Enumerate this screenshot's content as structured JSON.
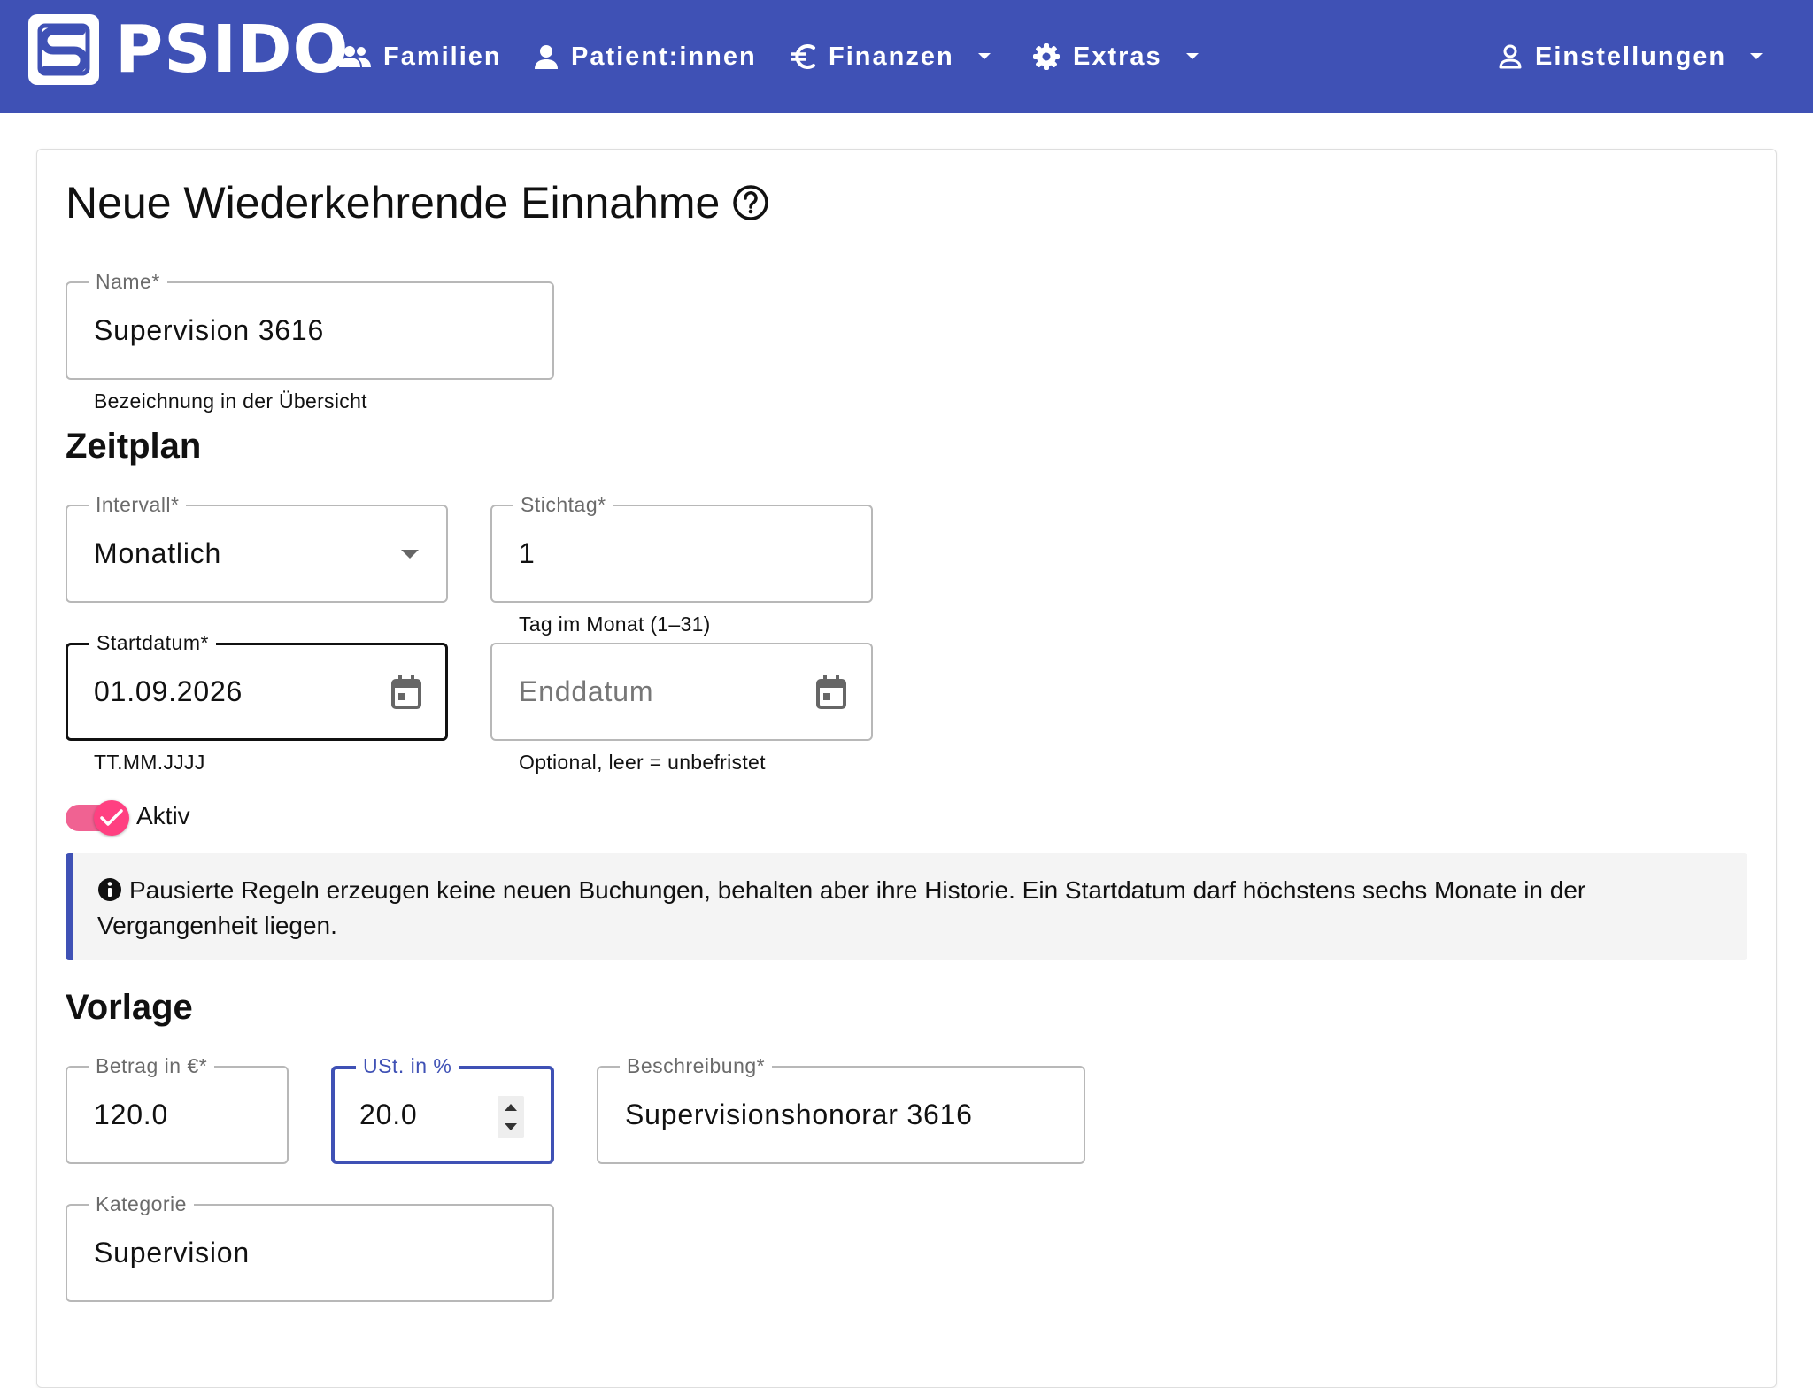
{
  "app": {
    "brand": "PSIDO",
    "colors": {
      "primary": "#3f51b5",
      "accent": "#ff4081",
      "accent_track": "#f06292"
    }
  },
  "nav": {
    "items": [
      {
        "label": "Familien",
        "icon": "group-icon"
      },
      {
        "label": "Patient:innen",
        "icon": "person-icon"
      },
      {
        "label": "Finanzen",
        "icon": "euro-icon",
        "dropdown": true
      },
      {
        "label": "Extras",
        "icon": "gear-icon",
        "dropdown": true
      }
    ],
    "settings": {
      "label": "Einstellungen",
      "icon": "person-outline-icon",
      "dropdown": true
    }
  },
  "page": {
    "title": "Neue Wiederkehrende Einnahme"
  },
  "form": {
    "name": {
      "label": "Name*",
      "value": "Supervision 3616",
      "helper": "Bezeichnung in der Übersicht"
    },
    "schedule_title": "Zeitplan",
    "interval": {
      "label": "Intervall*",
      "value": "Monatlich"
    },
    "stichtag": {
      "label": "Stichtag*",
      "value": "1",
      "helper": "Tag im Monat (1–31)"
    },
    "startdatum": {
      "label": "Startdatum*",
      "value": "01.09.2026",
      "helper": "TT.MM.JJJJ"
    },
    "enddatum": {
      "placeholder": "Enddatum",
      "helper": "Optional, leer = unbefristet"
    },
    "aktiv": {
      "label": "Aktiv",
      "checked": true
    },
    "info": "Pausierte Regeln erzeugen keine neuen Buchungen, behalten aber ihre Historie. Ein Startdatum darf höchstens sechs Monate in der Vergangenheit liegen.",
    "template_title": "Vorlage",
    "betrag": {
      "label": "Betrag in €*",
      "value": "120.0"
    },
    "ust": {
      "label": "USt. in %",
      "value": "20.0"
    },
    "beschreibung": {
      "label": "Beschreibung*",
      "value": "Supervisionshonorar 3616"
    },
    "kategorie": {
      "label": "Kategorie",
      "value": "Supervision"
    }
  }
}
